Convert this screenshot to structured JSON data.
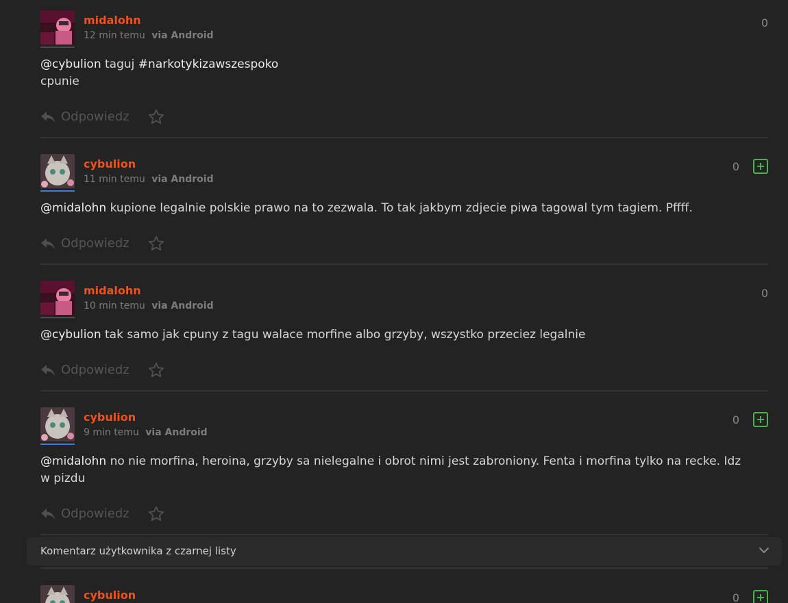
{
  "comments": [
    {
      "author": "midalohn",
      "time": "12 min temu",
      "via": "via Android",
      "score": "0",
      "mention": "@cybulion",
      "text1": " taguj ",
      "tag": "#narkotykizawszespoko",
      "text2": "cpunie",
      "reply_label": "Odpowiedz"
    },
    {
      "author": "cybulion",
      "time": "11 min temu",
      "via": "via Android",
      "score": "0",
      "mention": "@midalohn",
      "text1": " kupione legalnie polskie prawo na to zezwala. To tak jakbym zdjecie piwa tagowal tym tagiem. Pffff.",
      "reply_label": "Odpowiedz"
    },
    {
      "author": "midalohn",
      "time": "10 min temu",
      "via": "via Android",
      "score": "0",
      "mention": "@cybulion",
      "text1": " tak samo jak cpuny z tagu walace morfine albo grzyby, wszystko przeciez legalnie",
      "reply_label": "Odpowiedz"
    },
    {
      "author": "cybulion",
      "time": "9 min temu",
      "via": "via Android",
      "score": "0",
      "mention": "@midalohn",
      "text1": " no nie morfina, heroina, grzyby sa nielegalne i obrot nimi jest zabroniony. Fenta i morfina tylko na recke. Idz w pizdu",
      "reply_label": "Odpowiedz"
    },
    {
      "author": "cybulion",
      "score": "0"
    }
  ],
  "blacklist_label": "Komentarz użytkownika z czarnej listy",
  "icons": {
    "reply": "reply-arrow-icon",
    "star": "star-outline-icon",
    "plus": "plus-square-icon",
    "chevron": "chevron-down-icon"
  },
  "colors": {
    "author": "#f4511e",
    "plus": "#4caf50",
    "background": "#232323"
  }
}
